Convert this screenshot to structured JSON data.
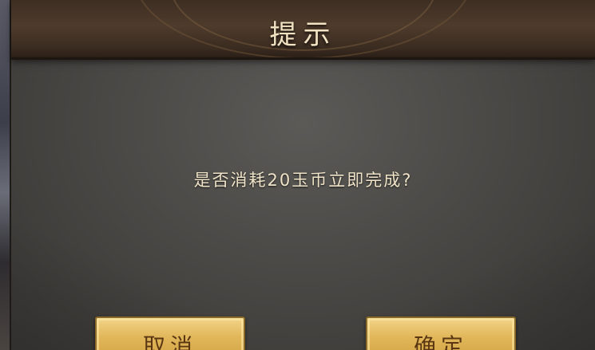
{
  "dialog": {
    "title": "提示",
    "message": "是否消耗20玉币立即完成?",
    "cancel_label": "取消",
    "confirm_label": "确定"
  },
  "colors": {
    "title_text": "#f1e2c2",
    "message_text": "#efe3c8",
    "button_gold": "#e2b85c",
    "button_text": "#5a3612",
    "header_brown": "#4e3b2c",
    "panel_gray": "#4d4b48"
  }
}
